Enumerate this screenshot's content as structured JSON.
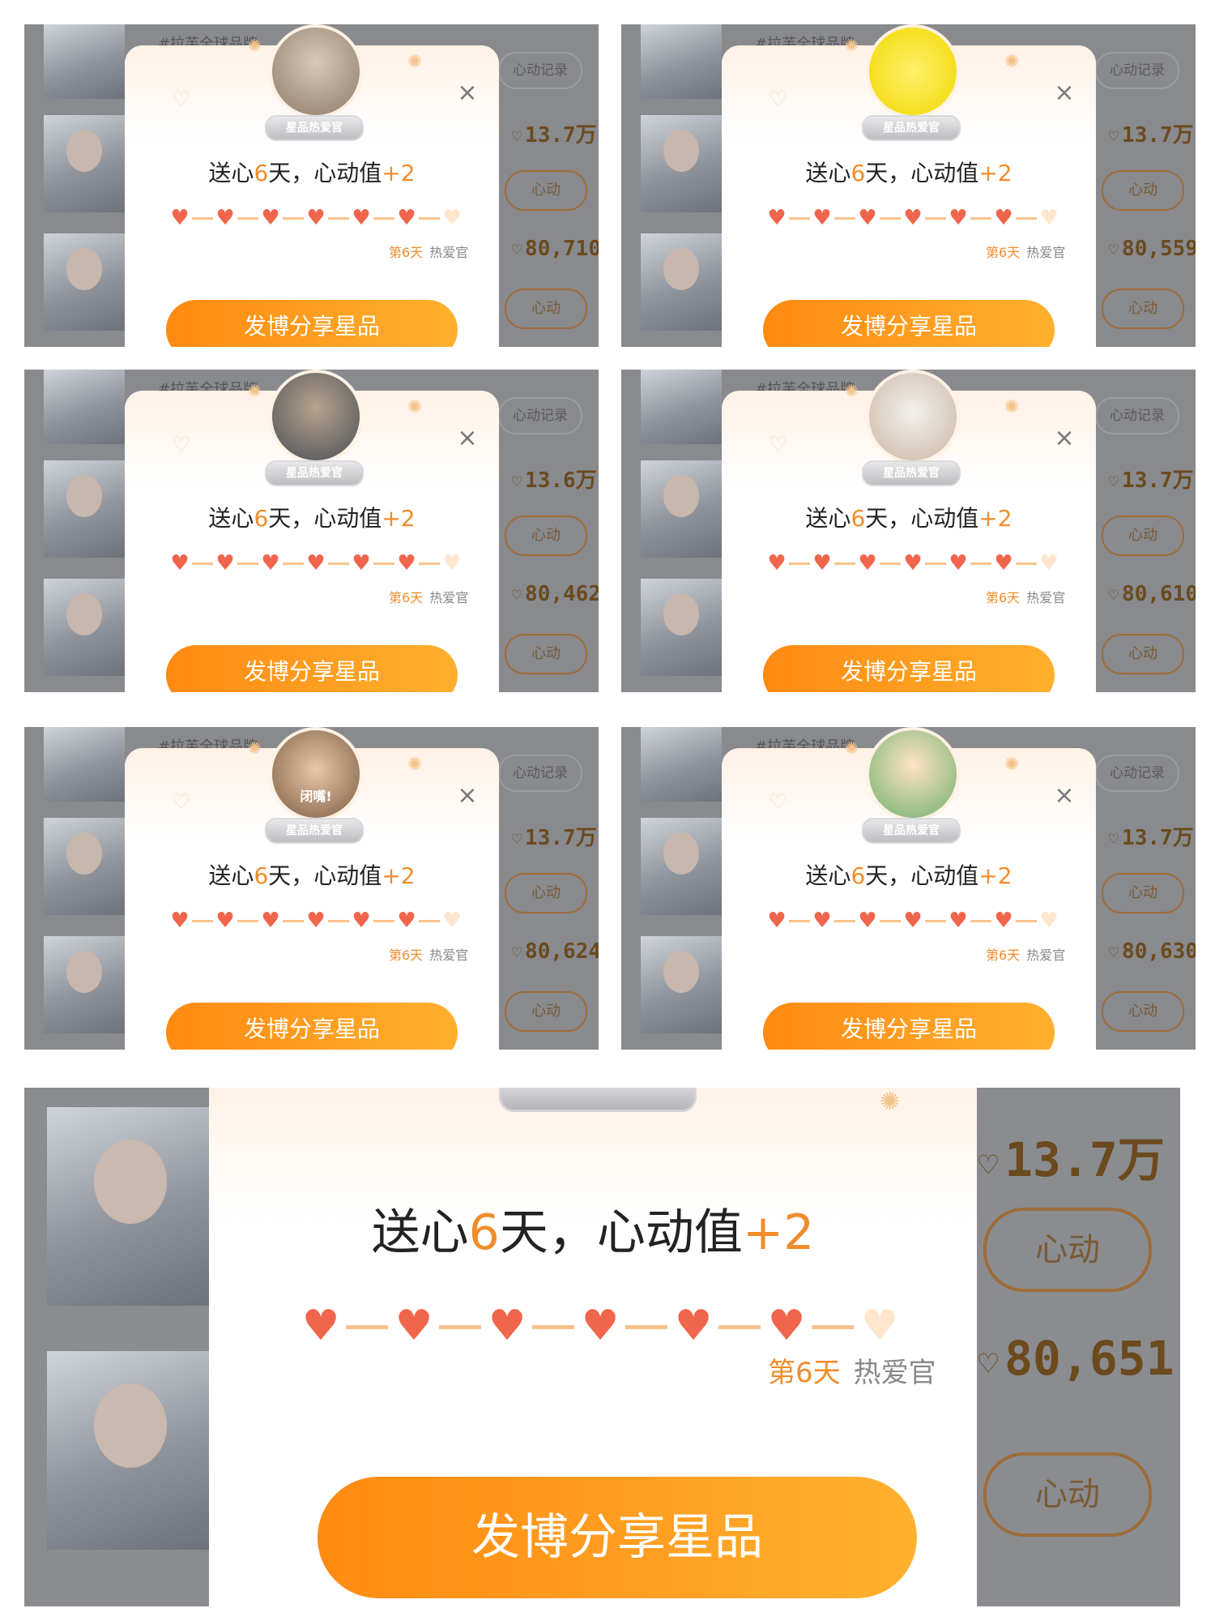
{
  "common": {
    "record_button": "心动记录",
    "badge": "星品热爱官",
    "title_prefix": "送心",
    "title_days": "6",
    "title_mid": "天，心动值",
    "title_plus": "+2",
    "day_label": "第6天",
    "role_label": "热爱官",
    "share_button": "发博分享星品",
    "xindong_button": "心动",
    "close_glyph": "×",
    "heart_glyph": "♡",
    "filled_heart_glyph": "♥",
    "bg_text": "#拉芙全球品牌"
  },
  "progress": {
    "filled": 6,
    "total": 7
  },
  "panels": [
    {
      "count_top": "13.7万",
      "count_bottom": "80,710"
    },
    {
      "count_top": "13.7万",
      "count_bottom": "80,559"
    },
    {
      "count_top": "13.6万",
      "count_bottom": "80,462"
    },
    {
      "count_top": "13.7万",
      "count_bottom": "80,610"
    },
    {
      "count_top": "13.7万",
      "count_bottom": "80,624",
      "avatar_caption": "闭嘴!"
    },
    {
      "count_top": "13.7万",
      "count_bottom": "80,630"
    }
  ],
  "big_panel": {
    "count_top": "13.7万",
    "count_bottom": "80,651"
  },
  "colors": {
    "accent": "#f08c2b",
    "heart": "#f0654b",
    "button_start": "#ff8a12",
    "button_end": "#ffb02e",
    "overlay": "#888a8e"
  }
}
